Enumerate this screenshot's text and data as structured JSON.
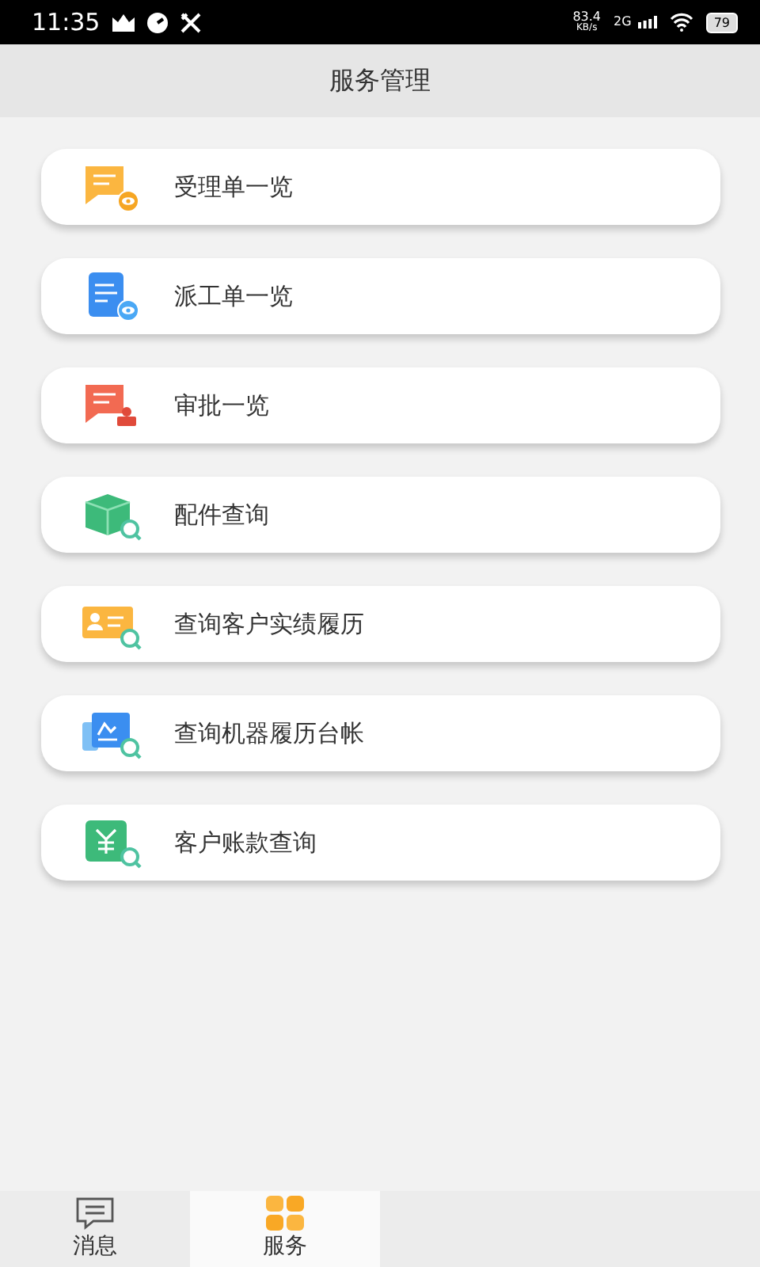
{
  "status_bar": {
    "time": "11:35",
    "speed": "83.4",
    "speed_unit": "KB/s",
    "network": "2G",
    "battery": "79"
  },
  "header": {
    "title": "服务管理"
  },
  "items": [
    {
      "label": "受理单一览",
      "kind": "acceptance"
    },
    {
      "label": "派工单一览",
      "kind": "dispatch"
    },
    {
      "label": "审批一览",
      "kind": "approval"
    },
    {
      "label": "配件查询",
      "kind": "parts"
    },
    {
      "label": "查询客户实绩履历",
      "kind": "customer"
    },
    {
      "label": "查询机器履历台帐",
      "kind": "machine"
    },
    {
      "label": "客户账款查询",
      "kind": "account"
    }
  ],
  "tabs": [
    {
      "label": "消息",
      "kind": "message",
      "selected": false
    },
    {
      "label": "服务",
      "kind": "service",
      "selected": true
    }
  ]
}
